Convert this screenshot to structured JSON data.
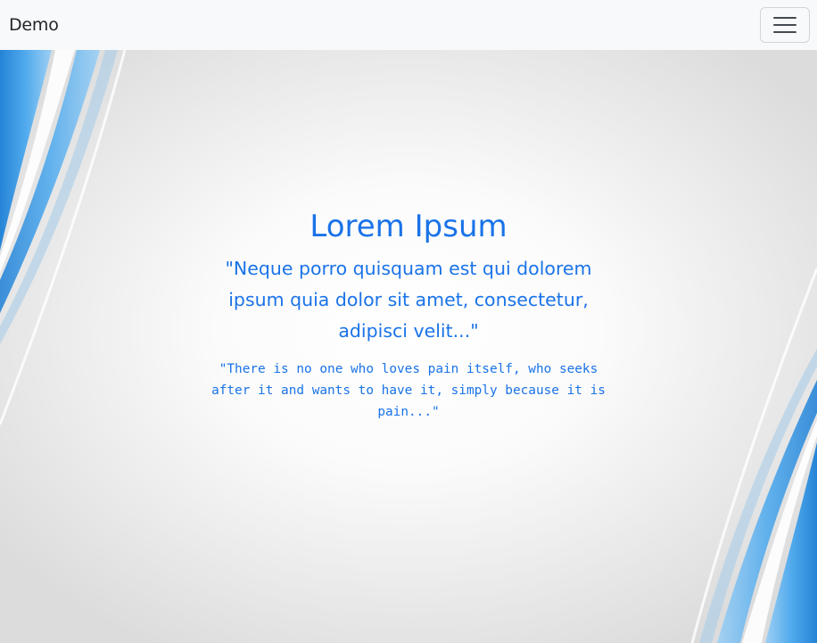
{
  "navbar": {
    "brand": "Demo",
    "toggler_icon": "hamburger-menu-icon"
  },
  "hero": {
    "title": "Lorem Ipsum",
    "quote": "\"Neque porro quisquam est qui dolorem ipsum quia dolor sit amet, consectetur, adipisci velit...\"",
    "subquote": "\"There is no one who loves pain itself, who seeks after it and wants to have it, simply because it is pain...\""
  },
  "colors": {
    "accent": "#1a73e8",
    "navbar_bg": "#f8f9fa",
    "brand_text": "#212529"
  }
}
